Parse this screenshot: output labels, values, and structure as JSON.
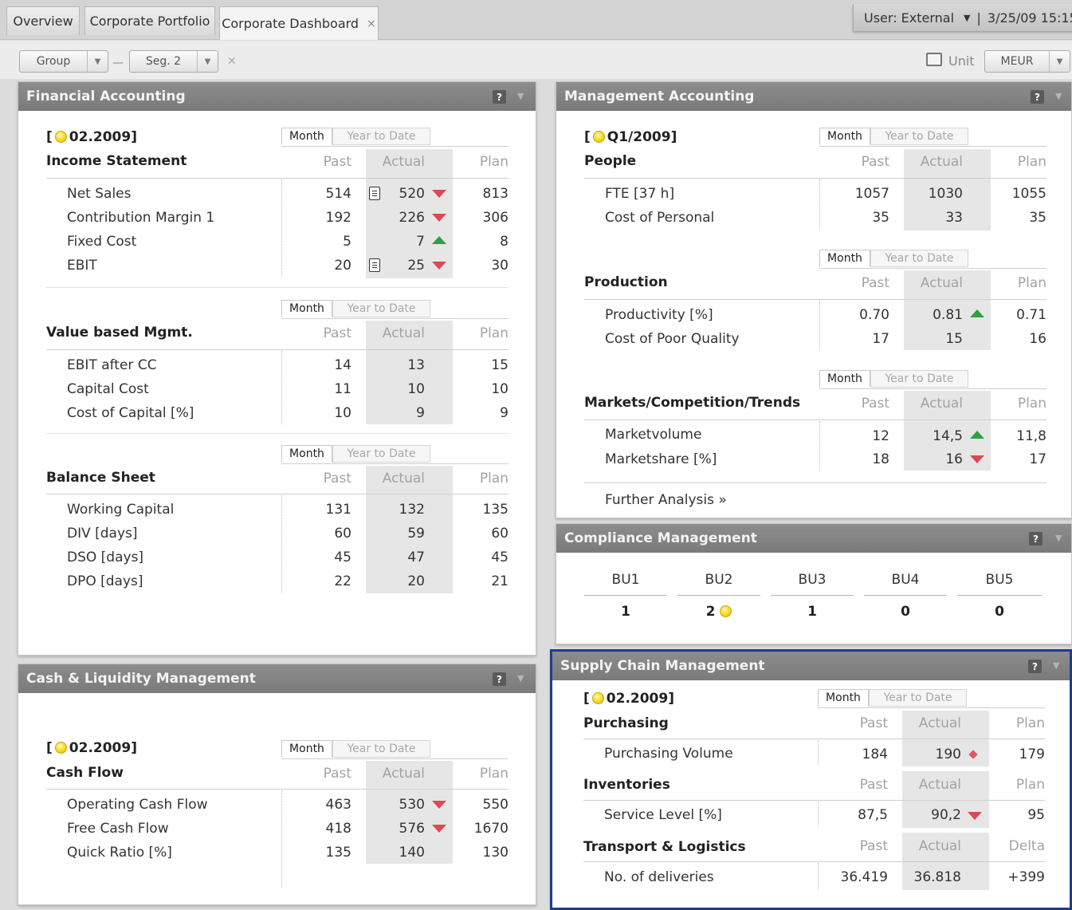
{
  "tabs": [
    {
      "label": "Overview"
    },
    {
      "label": "Corporate Portfolio"
    },
    {
      "label": "Corporate Dashboard",
      "close": "×"
    }
  ],
  "user": {
    "text": "User: External",
    "arrow": "▼",
    "sep": "|",
    "datetime": "3/25/09  15:15"
  },
  "toolbar": {
    "group": "Group",
    "segment": "Seg. 2",
    "dash": "—",
    "clear": "✕",
    "unit_label": "Unit",
    "unit_value": "MEUR"
  },
  "tabs_labels": {
    "month": "Month",
    "ytd": "Year to Date"
  },
  "cols": {
    "past": "Past",
    "actual": "Actual",
    "plan": "Plan",
    "delta": "Delta"
  },
  "financial": {
    "title": "Financial Accounting",
    "period": "02.2009",
    "income": {
      "title": "Income Statement",
      "rows": [
        {
          "label": "Net Sales",
          "past": "514",
          "actual": "520",
          "plan": "813",
          "trend": "down",
          "note": true
        },
        {
          "label": "Contribution Margin 1",
          "past": "192",
          "actual": "226",
          "plan": "306",
          "trend": "down"
        },
        {
          "label": "Fixed Cost",
          "past": "5",
          "actual": "7",
          "plan": "8",
          "trend": "up"
        },
        {
          "label": "EBIT",
          "past": "20",
          "actual": "25",
          "plan": "30",
          "trend": "down",
          "note": true
        }
      ]
    },
    "vbm": {
      "title": "Value based Mgmt.",
      "rows": [
        {
          "label": "EBIT after CC",
          "past": "14",
          "actual": "13",
          "plan": "15"
        },
        {
          "label": "Capital Cost",
          "past": "11",
          "actual": "10",
          "plan": "10"
        },
        {
          "label": "Cost of Capital [%]",
          "past": "10",
          "actual": "9",
          "plan": "9"
        }
      ]
    },
    "balance": {
      "title": "Balance Sheet",
      "rows": [
        {
          "label": "Working Capital",
          "past": "131",
          "actual": "132",
          "plan": "135"
        },
        {
          "label": "DIV  [days]",
          "past": "60",
          "actual": "59",
          "plan": "60"
        },
        {
          "label": "DSO  [days]",
          "past": "45",
          "actual": "47",
          "plan": "45"
        },
        {
          "label": "DPO  [days]",
          "past": "22",
          "actual": "20",
          "plan": "21"
        }
      ]
    }
  },
  "cash": {
    "title": "Cash & Liquidity Management",
    "period": "02.2009",
    "flow": {
      "title": "Cash Flow",
      "rows": [
        {
          "label": "Operating Cash Flow",
          "past": "463",
          "actual": "530",
          "plan": "550",
          "trend": "down"
        },
        {
          "label": "Free Cash Flow",
          "past": "418",
          "actual": "576",
          "plan": "1670",
          "trend": "down"
        },
        {
          "label": "Quick Ratio [%]",
          "past": "135",
          "actual": "140",
          "plan": "130"
        }
      ]
    }
  },
  "management": {
    "title": "Management Accounting",
    "period": "Q1/2009",
    "people": {
      "title": "People",
      "rows": [
        {
          "label": "FTE [37 h]",
          "past": "1057",
          "actual": "1030",
          "plan": "1055"
        },
        {
          "label": "Cost of Personal",
          "past": "35",
          "actual": "33",
          "plan": "35"
        }
      ]
    },
    "production": {
      "title": "Production",
      "rows": [
        {
          "label": "Productivity [%]",
          "past": "0.70",
          "actual": "0.81",
          "plan": "0.71",
          "trend": "up"
        },
        {
          "label": "Cost of Poor Quality",
          "past": "17",
          "actual": "15",
          "plan": "16"
        }
      ]
    },
    "markets": {
      "title": "Markets/Competition/Trends",
      "rows": [
        {
          "label": "Marketvolume",
          "past": "12",
          "actual": "14,5",
          "plan": "11,8",
          "trend": "up"
        },
        {
          "label": "Marketshare [%]",
          "past": "18",
          "actual": "16",
          "plan": "17",
          "trend": "down"
        }
      ]
    },
    "further": "Further Analysis »"
  },
  "compliance": {
    "title": "Compliance Management",
    "units": [
      {
        "name": "BU1",
        "value": "1"
      },
      {
        "name": "BU2",
        "value": "2",
        "dot": true
      },
      {
        "name": "BU3",
        "value": "1"
      },
      {
        "name": "BU4",
        "value": "0"
      },
      {
        "name": "BU5",
        "value": "0"
      }
    ]
  },
  "supply": {
    "title": "Supply Chain Management",
    "period": "02.2009",
    "purchasing": {
      "title": "Purchasing",
      "rows": [
        {
          "label": "Purchasing Volume",
          "past": "184",
          "actual": "190",
          "plan": "179",
          "trend": "diamond"
        }
      ]
    },
    "inventories": {
      "title": "Inventories",
      "rows": [
        {
          "label": "Service Level [%]",
          "past": "87,5",
          "actual": "90,2",
          "plan": "95",
          "trend": "down"
        }
      ]
    },
    "transport": {
      "title": "Transport & Logistics",
      "rows": [
        {
          "label": "No. of deliveries",
          "past": "36.419",
          "actual": "36.818",
          "plan": "+399"
        }
      ]
    }
  },
  "colors": {
    "up": "#2da14a",
    "down": "#d94a52",
    "header": "#848484",
    "highlight_border": "#1d3d8c",
    "status_yellow": "#f7d81f"
  },
  "icons": {
    "note": "document-icon",
    "help": "help-icon",
    "print": "printer-icon"
  }
}
